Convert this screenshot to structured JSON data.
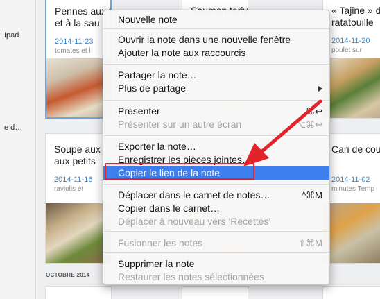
{
  "sidebar": {
    "items": [
      {
        "label": "Ipad"
      },
      {
        "label": "e d…"
      }
    ]
  },
  "notes": [
    {
      "title_lines": [
        "Pennes aux tomates",
        "et à la sau"
      ],
      "date": "2014-11-23",
      "snippet": "tomates et l"
    },
    {
      "title_lines": [
        "Saumon teriyaki"
      ],
      "date": "",
      "snippet": ""
    },
    {
      "title_lines": [
        "« Tajine » de",
        "ratatouille"
      ],
      "date": "2014-11-20",
      "snippet": "poulet sur"
    },
    {
      "title_lines": [
        "Soupe aux",
        "aux petits"
      ],
      "date": "2014-11-16",
      "snippet": "raviolis et"
    },
    {
      "title_lines": [
        "Cari de cou"
      ],
      "date": "2014-11-02",
      "snippet": "minutes Temp"
    }
  ],
  "section_label": "OCTOBRE 2014",
  "menu": {
    "groups": [
      [
        {
          "label": "Nouvelle note",
          "disabled": false
        }
      ],
      [
        {
          "label": "Ouvrir la note dans une nouvelle fenêtre",
          "disabled": false
        },
        {
          "label": "Ajouter la note aux raccourcis",
          "disabled": false
        }
      ],
      [
        {
          "label": "Partager la note…",
          "disabled": false
        },
        {
          "label": "Plus de partage",
          "disabled": false,
          "submenu": true
        }
      ],
      [
        {
          "label": "Présenter",
          "disabled": false,
          "shortcut": "⌘↩"
        },
        {
          "label": "Présenter sur un autre écran",
          "disabled": true,
          "shortcut": "⌥⌘↩"
        }
      ],
      [
        {
          "label": "Exporter la note…",
          "disabled": false
        },
        {
          "label": "Enregistrer les pièces jointes…",
          "disabled": false
        },
        {
          "label": "Copier le lien de la note",
          "disabled": false,
          "highlighted": true
        }
      ],
      [
        {
          "label": "Déplacer dans le carnet de notes…",
          "disabled": false,
          "shortcut": "^⌘M"
        },
        {
          "label": "Copier dans le carnet…",
          "disabled": false
        },
        {
          "label": "Déplacer à nouveau vers 'Recettes'",
          "disabled": true
        }
      ],
      [
        {
          "label": "Fusionner les notes",
          "disabled": true,
          "shortcut": "⇧⌘M"
        }
      ],
      [
        {
          "label": "Supprimer la note",
          "disabled": false
        },
        {
          "label": "Restaurer les notes sélectionnées",
          "disabled": true
        }
      ]
    ]
  },
  "colors": {
    "highlight": "#3e7ff0",
    "callout": "#e0242a",
    "date_blue": "#3d85c6"
  }
}
